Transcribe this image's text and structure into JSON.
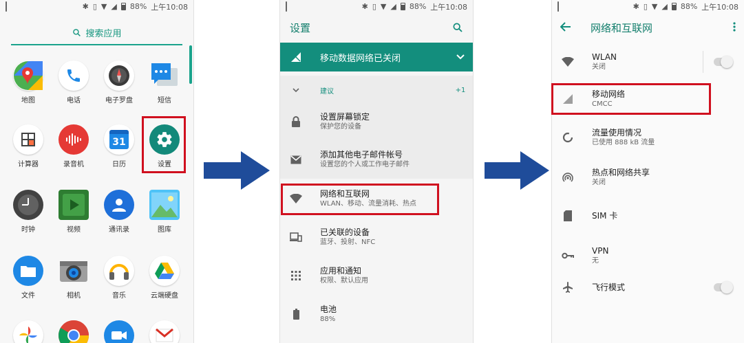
{
  "status": {
    "battery": "88%",
    "time": "上午10:08"
  },
  "launcher": {
    "search_label": "搜索应用",
    "apps": [
      {
        "label": "地图",
        "icon": "maps-icon"
      },
      {
        "label": "电话",
        "icon": "phone-icon"
      },
      {
        "label": "电子罗盘",
        "icon": "compass-icon"
      },
      {
        "label": "短信",
        "icon": "messages-icon"
      },
      {
        "label": "计算器",
        "icon": "calculator-icon"
      },
      {
        "label": "录音机",
        "icon": "recorder-icon"
      },
      {
        "label": "日历",
        "icon": "calendar-icon",
        "badge": "31"
      },
      {
        "label": "设置",
        "icon": "settings-gear-icon"
      },
      {
        "label": "时钟",
        "icon": "clock-icon"
      },
      {
        "label": "视频",
        "icon": "video-play-icon"
      },
      {
        "label": "通讯录",
        "icon": "contacts-icon"
      },
      {
        "label": "图库",
        "icon": "gallery-icon"
      },
      {
        "label": "文件",
        "icon": "folder-icon"
      },
      {
        "label": "相机",
        "icon": "camera-icon"
      },
      {
        "label": "音乐",
        "icon": "headphones-icon"
      },
      {
        "label": "云端硬盘",
        "icon": "drive-icon"
      }
    ]
  },
  "settings": {
    "title": "设置",
    "banner": "移动数据网络已关闭",
    "suggestions_label": "建议",
    "suggestions_count": "+1",
    "suggestions": [
      {
        "title": "设置屏幕锁定",
        "subtitle": "保护您的设备",
        "icon": "lock-icon"
      },
      {
        "title": "添加其他电子邮件帐号",
        "subtitle": "设置您的个人或工作电子邮件",
        "icon": "mail-icon"
      }
    ],
    "items": [
      {
        "title": "网络和互联网",
        "subtitle": "WLAN、移动、流量消耗、热点",
        "icon": "wifi-icon"
      },
      {
        "title": "已关联的设备",
        "subtitle": "蓝牙、投射、NFC",
        "icon": "devices-icon"
      },
      {
        "title": "应用和通知",
        "subtitle": "权限、默认应用",
        "icon": "apps-grid-icon"
      },
      {
        "title": "电池",
        "subtitle": "88%",
        "icon": "battery-icon"
      }
    ]
  },
  "network": {
    "title": "网络和互联网",
    "items": [
      {
        "title": "WLAN",
        "subtitle": "关闭",
        "icon": "wifi-icon"
      },
      {
        "title": "移动网络",
        "subtitle": "CMCC",
        "icon": "cellular-signal-icon"
      },
      {
        "title": "流量使用情况",
        "subtitle": "已使用 888 kB 流量",
        "icon": "data-usage-icon"
      },
      {
        "title": "热点和网络共享",
        "subtitle": "关闭",
        "icon": "hotspot-icon"
      },
      {
        "title": "SIM 卡",
        "subtitle": "",
        "icon": "sim-card-icon"
      },
      {
        "title": "VPN",
        "subtitle": "无",
        "icon": "vpn-key-icon"
      },
      {
        "title": "飞行模式",
        "subtitle": "",
        "icon": "airplane-icon"
      }
    ]
  },
  "colors": {
    "accent": "#138e7d",
    "highlight": "#d0101f",
    "arrow": "#1f4c9a"
  }
}
